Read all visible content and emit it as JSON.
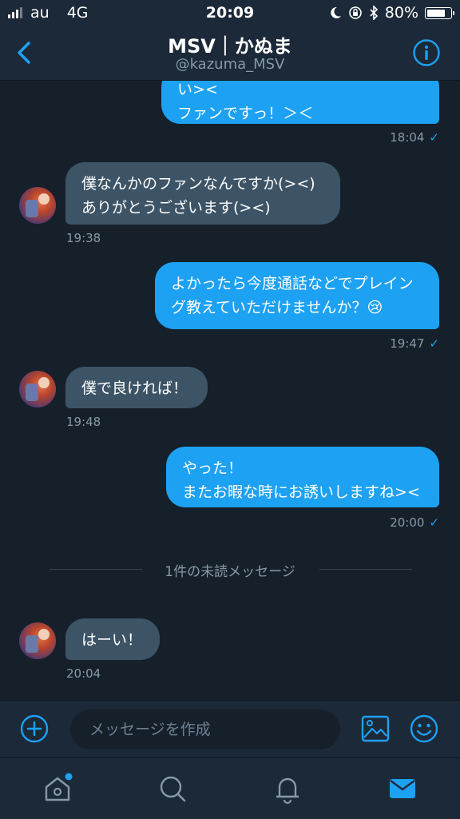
{
  "status_bar": {
    "carrier": "au",
    "network": "4G",
    "time": "20:09",
    "battery_percent": "80%",
    "battery_level": 0.8
  },
  "header": {
    "title": "MSV｜かぬま",
    "handle": "@kazuma_MSV",
    "back_icon": "chevron-left-icon",
    "info_icon": "info-icon"
  },
  "messages": [
    {
      "direction": "sent",
      "text": "い><\nファンですっ！＞＜",
      "time": "18:04",
      "read": "✓"
    },
    {
      "direction": "received",
      "text": "僕なんかのファンなんですか(><)\nありがとうございます(><)",
      "time": "19:38"
    },
    {
      "direction": "sent",
      "text": "よかったら今度通話などでプレイン\nグ教えていただけませんか？😢",
      "time": "19:47",
      "read": "✓"
    },
    {
      "direction": "received",
      "text": "僕で良ければ！",
      "time": "19:48"
    },
    {
      "direction": "sent",
      "text": "やった！\nまたお暇な時にお誘いしますね><",
      "time": "20:00",
      "read": "✓"
    },
    {
      "direction": "received",
      "text": "はーい！",
      "time": "20:04"
    }
  ],
  "unread_divider": "1件の未読メッセージ",
  "composer": {
    "placeholder": "メッセージを作成",
    "add_icon": "plus-circle-icon",
    "image_icon": "image-icon",
    "emoji_icon": "smiley-icon"
  },
  "tabbar": {
    "items": [
      {
        "icon": "home-icon",
        "notification_dot": true
      },
      {
        "icon": "search-icon"
      },
      {
        "icon": "bell-icon"
      },
      {
        "icon": "mail-icon",
        "active": true
      }
    ]
  },
  "colors": {
    "background": "#15202b",
    "bar": "#1c2938",
    "accent": "#1da1f2",
    "received_bubble": "#3d5466",
    "muted_text": "#8899a6"
  }
}
